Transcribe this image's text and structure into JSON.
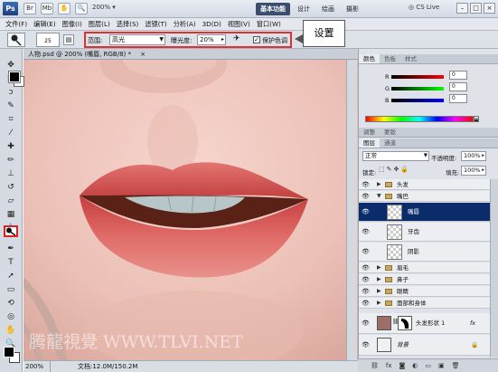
{
  "app": {
    "logo": "Ps",
    "zoom_combo": "200%",
    "workspaces": [
      "基本功能",
      "设计",
      "绘画",
      "摄影"
    ],
    "cs_live": "CS Live",
    "window_buttons": [
      "–",
      "□",
      "×"
    ]
  },
  "menu": [
    "文件(F)",
    "编辑(E)",
    "图像(I)",
    "图层(L)",
    "选择(S)",
    "滤镜(T)",
    "分析(A)",
    "3D(D)",
    "视图(V)",
    "窗口(W)"
  ],
  "options": {
    "brush_size": "25",
    "range_label": "范围:",
    "range_value": "高光",
    "exposure_label": "曝光度:",
    "exposure_value": "20%",
    "protect_tones_label": "保护色调",
    "protect_tones_checked": true
  },
  "callout": {
    "text": "设置"
  },
  "tools": {
    "icons": [
      "move-icon",
      "marquee-icon",
      "lasso-icon",
      "quick-select-icon",
      "crop-icon",
      "eyedropper-icon",
      "healing-icon",
      "brush-icon",
      "clone-stamp-icon",
      "history-brush-icon",
      "eraser-icon",
      "gradient-icon",
      "blur-icon",
      "dodge-icon",
      "pen-icon",
      "type-icon",
      "path-select-icon",
      "shape-icon",
      "3d-rotate-icon",
      "3d-orbit-icon",
      "hand-icon",
      "zoom-icon"
    ],
    "selected": "dodge-icon"
  },
  "document": {
    "tab_title": "人物.psd @ 200% (嘴唇, RGB/8) *",
    "tab_close": "×",
    "status_zoom": "200%",
    "status_doc": "文档:12.0M/150.2M",
    "watermark": "腾龍視覺 WWW.TLVI.NET"
  },
  "color_panel": {
    "tabs": [
      "颜色",
      "色板",
      "样式"
    ],
    "channels": [
      {
        "label": "R",
        "value": "0",
        "color": "#d22"
      },
      {
        "label": "G",
        "value": "0",
        "color": "#2a2"
      },
      {
        "label": "B",
        "value": "0",
        "color": "#22d"
      }
    ],
    "foreground": "#000000",
    "background": "#ffffff"
  },
  "adjust_panel": {
    "tabs": [
      "调整",
      "蒙版"
    ]
  },
  "layers_panel": {
    "tabs": [
      "图层",
      "通道"
    ],
    "blend_mode": "正常",
    "opacity_label": "不透明度:",
    "opacity_value": "100%",
    "lock_label": "锁定:",
    "fill_label": "填充:",
    "fill_value": "100%",
    "layers": [
      {
        "name": "头发",
        "type": "group",
        "expanded": false
      },
      {
        "name": "嘴巴",
        "type": "group",
        "expanded": true
      },
      {
        "name": "嘴唇",
        "type": "layer",
        "selected": true
      },
      {
        "name": "牙齿",
        "type": "layer"
      },
      {
        "name": "阴影",
        "type": "layer"
      },
      {
        "name": "眉毛",
        "type": "group",
        "expanded": false
      },
      {
        "name": "鼻子",
        "type": "group",
        "expanded": false
      },
      {
        "name": "眼睛",
        "type": "group",
        "expanded": false
      },
      {
        "name": "面部和身体",
        "type": "group",
        "expanded": false
      },
      {
        "name": "头发形状 1",
        "type": "shape",
        "fx": "fx"
      },
      {
        "name": "背景",
        "type": "background"
      }
    ],
    "footer_icons": [
      "link-icon",
      "fx-icon",
      "mask-icon",
      "adjustment-icon",
      "folder-icon",
      "new-layer-icon",
      "trash-icon"
    ]
  }
}
